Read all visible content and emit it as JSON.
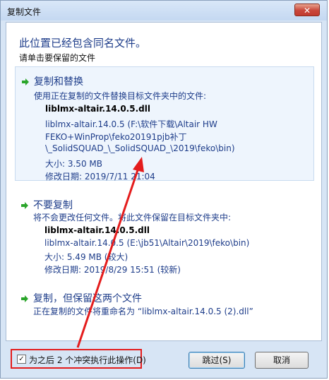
{
  "window": {
    "title": "复制文件",
    "close_label": "✕"
  },
  "heading": "此位置已经包含同名文件。",
  "subheading": "请单击要保留的文件",
  "options": [
    {
      "title": "复制和替换",
      "description": "使用正在复制的文件替换目标文件夹中的文件:",
      "file_name": "liblmx-altair.14.0.5.dll",
      "path_lines": [
        "liblmx-altair.14.0.5 (F:\\软件下载\\Altair HW",
        "FEKO+WinProp\\feko20191pjb补丁",
        "\\_SolidSQUAD_\\_SolidSQUAD_\\2019\\feko\\bin)"
      ],
      "size": "大小: 3.50 MB",
      "modified": "修改日期: 2019/7/11 21:04"
    },
    {
      "title": "不要复制",
      "description": "将不会更改任何文件。将此文件保留在目标文件夹中:",
      "file_name": "liblmx-altair.14.0.5.dll",
      "path_lines": [
        "liblmx-altair.14.0.5 (E:\\jb51\\Altair\\2019\\feko\\bin)"
      ],
      "size": "大小: 5.49 MB (较大)",
      "modified": "修改日期: 2019/8/29 15:51 (较新)"
    },
    {
      "title": "复制，但保留这两个文件",
      "description": "正在复制的文件将重命名为 “liblmx-altair.14.0.5 (2).dll”"
    }
  ],
  "footer": {
    "checkbox_label": "为之后 2 个冲突执行此操作(D)",
    "checkbox_checked": true,
    "skip_label": "跳过(S)",
    "cancel_label": "取消"
  },
  "colors": {
    "accent": "#1e3d8a",
    "annotation": "#e41c1c",
    "arrow_icon": "#2aa52a"
  }
}
